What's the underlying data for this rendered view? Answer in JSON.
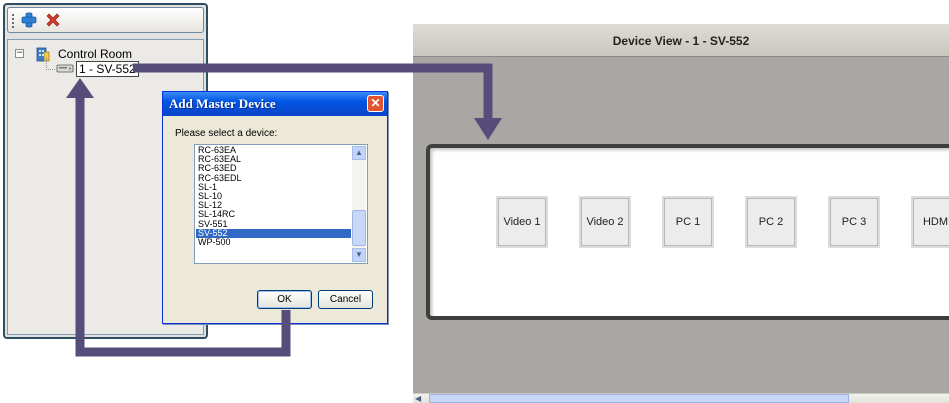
{
  "tree": {
    "root_label": "Control Room",
    "expander_glyph": "−",
    "device_label": "1 - SV-552"
  },
  "toolbar": {
    "add_icon": "plus-icon",
    "delete_icon": "delete-x-icon"
  },
  "dialog": {
    "title": "Add Master Device",
    "close_glyph": "✕",
    "prompt": "Please select a device:",
    "devices": [
      "RC-63EA",
      "RC-63EAL",
      "RC-63ED",
      "RC-63EDL",
      "SL-1",
      "SL-10",
      "SL-12",
      "SL-14RC",
      "SV-551",
      "SV-552",
      "WP-500"
    ],
    "selected_device": "SV-552",
    "ok_label": "OK",
    "cancel_label": "Cancel",
    "scroll_up_glyph": "▲",
    "scroll_down_glyph": "▼"
  },
  "device_view": {
    "title": "Device View - 1 - SV-552",
    "sources": [
      "Video 1",
      "Video 2",
      "PC 1",
      "PC 2",
      "PC 3",
      "HDMI"
    ],
    "scroll_left_glyph": "◀"
  },
  "colors": {
    "arrow": "#574d7a",
    "title_blue": "#0054e3",
    "selection": "#316ac5"
  }
}
